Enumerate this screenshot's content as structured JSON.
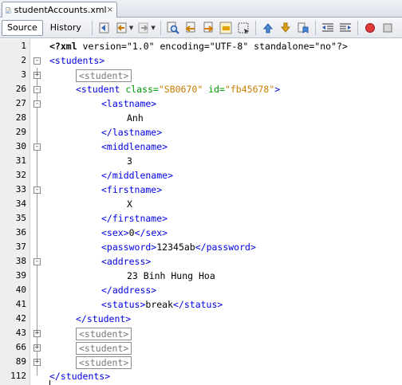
{
  "tab": {
    "title": "studentAccounts.xml",
    "close_glyph": "×"
  },
  "toolbar": {
    "source_label": "Source",
    "history_label": "History",
    "icons": [
      "last-edit-icon",
      "back-icon",
      "forward-icon",
      "find-icon",
      "find-previous-icon",
      "find-next-icon",
      "toggle-highlight-icon",
      "toggle-rect-selection-icon",
      "previous-bookmark-icon",
      "next-bookmark-icon",
      "toggle-bookmark-icon",
      "shift-left-icon",
      "shift-right-icon",
      "start-macro-icon",
      "stop-macro-icon"
    ]
  },
  "editor": {
    "lines": [
      {
        "num": "1",
        "fold": "",
        "text": ""
      },
      {
        "num": "2",
        "fold": "-",
        "text": "<students>"
      },
      {
        "num": "3",
        "fold": "+",
        "text": "<student>"
      },
      {
        "num": "26",
        "fold": "-",
        "text": ""
      },
      {
        "num": "27",
        "fold": "-",
        "text": "<lastname>"
      },
      {
        "num": "28",
        "fold": "",
        "text": "Anh"
      },
      {
        "num": "29",
        "fold": "",
        "text": "</lastname>"
      },
      {
        "num": "30",
        "fold": "-",
        "text": "<middlename>"
      },
      {
        "num": "31",
        "fold": "",
        "text": "3"
      },
      {
        "num": "32",
        "fold": "",
        "text": "</middlename>"
      },
      {
        "num": "33",
        "fold": "-",
        "text": "<firstname>"
      },
      {
        "num": "34",
        "fold": "",
        "text": "X"
      },
      {
        "num": "35",
        "fold": "",
        "text": "</firstname>"
      },
      {
        "num": "36",
        "fold": "",
        "text": ""
      },
      {
        "num": "37",
        "fold": "",
        "text": ""
      },
      {
        "num": "38",
        "fold": "-",
        "text": "<address>"
      },
      {
        "num": "39",
        "fold": "",
        "text": "23 Binh Hung Hoa"
      },
      {
        "num": "40",
        "fold": "",
        "text": "</address>"
      },
      {
        "num": "41",
        "fold": "",
        "text": ""
      },
      {
        "num": "42",
        "fold": "",
        "text": "</student>"
      },
      {
        "num": "43",
        "fold": "+",
        "text": "<student>"
      },
      {
        "num": "66",
        "fold": "+",
        "text": "<student>"
      },
      {
        "num": "89",
        "fold": "+",
        "text": "<student>"
      },
      {
        "num": "112",
        "fold": "",
        "text": "</students>"
      }
    ],
    "xml_decl": {
      "open": "<?xml",
      "rest": " version=\"1.0\" encoding=\"UTF-8\" standalone=\"no\"?>"
    },
    "student_open": {
      "tag": "<student",
      "attr1": " class=",
      "val1": "\"SB0670\"",
      "attr2": " id=",
      "val2": "\"fb45678\"",
      "close": ">"
    },
    "sex": {
      "open": "<sex>",
      "value": "0",
      "close": "</sex>"
    },
    "password": {
      "open": "<password>",
      "value": "12345ab",
      "close": "</password>"
    },
    "status": {
      "open": "<status>",
      "value": "break",
      "close": "</status>"
    }
  }
}
